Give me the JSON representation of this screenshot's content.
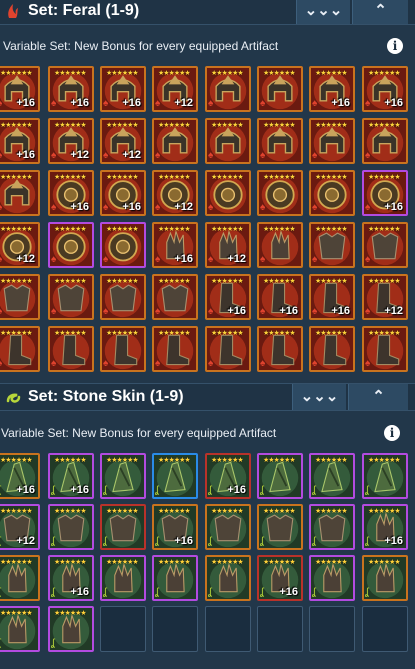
{
  "sets": [
    {
      "title": "Set: Feral (1-9)",
      "icon": "feral-claw-icon",
      "icon_color": "#e0432e",
      "collapse_label": "⌄⌄⌄",
      "expand_label": "⌃",
      "subtitle": "Variable Set: New Bonus for every equipped Artifact",
      "info_label": "i",
      "stars_label": "★★★★★★",
      "rows": [
        [
          {
            "kind": "helmet",
            "rarity": "legend",
            "level": "+16"
          },
          {
            "kind": "helmet",
            "rarity": "legend",
            "level": "+16"
          },
          {
            "kind": "helmet",
            "rarity": "legend",
            "level": "+16"
          },
          {
            "kind": "helmet",
            "rarity": "legend",
            "level": "+12"
          },
          {
            "kind": "helmet",
            "rarity": "legend",
            "level": ""
          },
          {
            "kind": "helmet",
            "rarity": "legend",
            "level": ""
          },
          {
            "kind": "helmet",
            "rarity": "legend",
            "level": "+16"
          },
          {
            "kind": "helmet",
            "rarity": "legend",
            "level": "+16"
          }
        ],
        [
          {
            "kind": "helmet",
            "rarity": "legend",
            "level": "+16"
          },
          {
            "kind": "helmet",
            "rarity": "legend",
            "level": "+12"
          },
          {
            "kind": "helmet",
            "rarity": "legend",
            "level": "+12"
          },
          {
            "kind": "helmet",
            "rarity": "legend",
            "level": ""
          },
          {
            "kind": "helmet",
            "rarity": "legend",
            "level": ""
          },
          {
            "kind": "helmet",
            "rarity": "legend",
            "level": ""
          },
          {
            "kind": "helmet",
            "rarity": "legend",
            "level": ""
          },
          {
            "kind": "helmet",
            "rarity": "legend",
            "level": ""
          }
        ],
        [
          {
            "kind": "helmet",
            "rarity": "legend",
            "level": ""
          },
          {
            "kind": "shield",
            "rarity": "legend",
            "level": "+16"
          },
          {
            "kind": "shield",
            "rarity": "legend",
            "level": "+16"
          },
          {
            "kind": "shield",
            "rarity": "legend",
            "level": "+12"
          },
          {
            "kind": "shield",
            "rarity": "legend",
            "level": ""
          },
          {
            "kind": "shield",
            "rarity": "legend",
            "level": ""
          },
          {
            "kind": "shield",
            "rarity": "legend",
            "level": ""
          },
          {
            "kind": "shield",
            "rarity": "epic",
            "level": "+16"
          }
        ],
        [
          {
            "kind": "shield",
            "rarity": "legend",
            "level": "+12"
          },
          {
            "kind": "shield",
            "rarity": "epic",
            "level": ""
          },
          {
            "kind": "shield",
            "rarity": "epic",
            "level": ""
          },
          {
            "kind": "glove",
            "rarity": "legend",
            "level": "+16"
          },
          {
            "kind": "glove",
            "rarity": "legend",
            "level": "+12"
          },
          {
            "kind": "glove",
            "rarity": "legend",
            "level": ""
          },
          {
            "kind": "chest",
            "rarity": "legend",
            "level": ""
          },
          {
            "kind": "chest",
            "rarity": "legend",
            "level": ""
          }
        ],
        [
          {
            "kind": "chest",
            "rarity": "legend",
            "level": ""
          },
          {
            "kind": "chest",
            "rarity": "legend",
            "level": ""
          },
          {
            "kind": "chest",
            "rarity": "legend",
            "level": ""
          },
          {
            "kind": "chest",
            "rarity": "legend",
            "level": ""
          },
          {
            "kind": "boot",
            "rarity": "legend",
            "level": "+16"
          },
          {
            "kind": "boot",
            "rarity": "legend",
            "level": "+16"
          },
          {
            "kind": "boot",
            "rarity": "legend",
            "level": "+16"
          },
          {
            "kind": "boot",
            "rarity": "legend",
            "level": "+12"
          }
        ],
        [
          {
            "kind": "boot",
            "rarity": "legend",
            "level": ""
          },
          {
            "kind": "boot",
            "rarity": "legend",
            "level": ""
          },
          {
            "kind": "boot",
            "rarity": "legend",
            "level": ""
          },
          {
            "kind": "boot",
            "rarity": "legend",
            "level": ""
          },
          {
            "kind": "boot",
            "rarity": "legend",
            "level": ""
          },
          {
            "kind": "boot",
            "rarity": "legend",
            "level": ""
          },
          {
            "kind": "boot",
            "rarity": "legend",
            "level": ""
          },
          {
            "kind": "boot",
            "rarity": "legend",
            "level": ""
          }
        ]
      ]
    },
    {
      "title": "Set: Stone Skin (1-9)",
      "icon": "stone-skin-icon",
      "icon_color": "#b7d63a",
      "collapse_label": "⌄⌄⌄",
      "expand_label": "⌃",
      "subtitle": "Variable Set: New Bonus for every equipped Artifact",
      "info_label": "i",
      "stars_label": "★★★★★★",
      "rows": [
        [
          {
            "kind": "weapon",
            "rarity": "legend",
            "level": "+16"
          },
          {
            "kind": "weapon",
            "rarity": "epic",
            "level": "+16"
          },
          {
            "kind": "weapon",
            "rarity": "epic",
            "level": ""
          },
          {
            "kind": "weapon",
            "rarity": "rare",
            "level": ""
          },
          {
            "kind": "weapon",
            "rarity": "red",
            "level": "+16"
          },
          {
            "kind": "weapon",
            "rarity": "epic",
            "level": ""
          },
          {
            "kind": "weapon",
            "rarity": "epic",
            "level": ""
          },
          {
            "kind": "weapon",
            "rarity": "epic",
            "level": ""
          }
        ],
        [
          {
            "kind": "chest",
            "rarity": "epic",
            "level": "+12"
          },
          {
            "kind": "chest",
            "rarity": "epic",
            "level": ""
          },
          {
            "kind": "chest",
            "rarity": "red",
            "level": ""
          },
          {
            "kind": "chest",
            "rarity": "legend",
            "level": "+16"
          },
          {
            "kind": "chest",
            "rarity": "legend",
            "level": ""
          },
          {
            "kind": "chest",
            "rarity": "legend",
            "level": ""
          },
          {
            "kind": "chest",
            "rarity": "epic",
            "level": ""
          },
          {
            "kind": "glove",
            "rarity": "epic",
            "level": "+16"
          }
        ],
        [
          {
            "kind": "glove",
            "rarity": "legend",
            "level": ""
          },
          {
            "kind": "glove",
            "rarity": "epic",
            "level": "+16"
          },
          {
            "kind": "glove",
            "rarity": "epic",
            "level": ""
          },
          {
            "kind": "glove",
            "rarity": "epic",
            "level": ""
          },
          {
            "kind": "glove",
            "rarity": "legend",
            "level": ""
          },
          {
            "kind": "glove",
            "rarity": "red",
            "level": "+16"
          },
          {
            "kind": "glove",
            "rarity": "epic",
            "level": ""
          },
          {
            "kind": "glove",
            "rarity": "legend",
            "level": ""
          }
        ],
        [
          {
            "kind": "glove",
            "rarity": "epic",
            "level": ""
          },
          {
            "kind": "glove",
            "rarity": "epic",
            "level": ""
          },
          {
            "kind": "empty"
          },
          {
            "kind": "empty"
          },
          {
            "kind": "empty"
          },
          {
            "kind": "empty"
          },
          {
            "kind": "empty"
          },
          {
            "kind": "empty"
          }
        ]
      ]
    }
  ]
}
